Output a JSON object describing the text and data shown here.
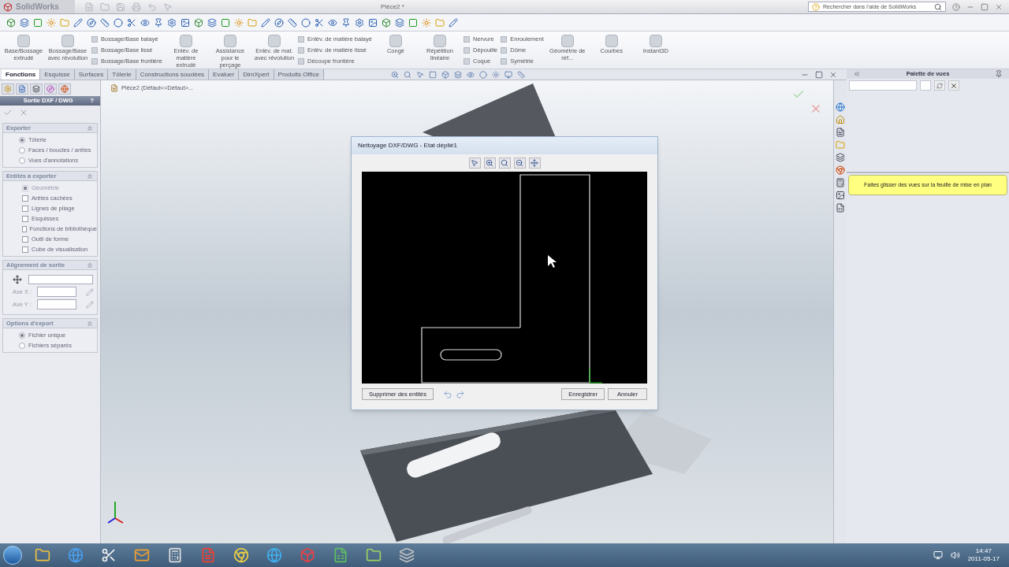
{
  "app_bar": {
    "logo": "SolidWorks",
    "title": "Pièce2 *",
    "search": {
      "placeholder": "Rechercher dans l'aide de SolidWorks"
    }
  },
  "ribbon": [
    {
      "kind": "large",
      "label": "Base/Bossage extrudé"
    },
    {
      "kind": "large",
      "label": "Bossage/Base avec révolution"
    },
    {
      "kind": "stack",
      "labels": [
        "Bossage/Base balayé",
        "Bossage/Base lissé",
        "Bossage/Base frontière"
      ]
    },
    {
      "kind": "large",
      "label": "Enlèv. de matière extrudé"
    },
    {
      "kind": "large",
      "label": "Assistance pour le perçage"
    },
    {
      "kind": "large",
      "label": "Enlèv. de mat. avec révolution"
    },
    {
      "kind": "stack",
      "labels": [
        "Enlèv. de matière balayé",
        "Enlèv. de matière lissé",
        "Découpe frontière"
      ]
    },
    {
      "kind": "large",
      "label": "Congé"
    },
    {
      "kind": "large",
      "label": "Répétition linéaire"
    },
    {
      "kind": "stack",
      "labels": [
        "Nervure",
        "Dépouille",
        "Coque"
      ]
    },
    {
      "kind": "stack",
      "labels": [
        "Enroulement",
        "Dôme",
        "Symétrie"
      ]
    },
    {
      "kind": "large",
      "label": "Géométrie de réf..."
    },
    {
      "kind": "large",
      "label": "Courbes"
    },
    {
      "kind": "large",
      "label": "Instant3D"
    }
  ],
  "tabs": [
    {
      "label": "Fonctions",
      "selected": true
    },
    {
      "label": "Esquisse",
      "selected": false
    },
    {
      "label": "Surfaces",
      "selected": false
    },
    {
      "label": "Tôlerie",
      "selected": false
    },
    {
      "label": "Constructions soudées",
      "selected": false
    },
    {
      "label": "Evaluer",
      "selected": false
    },
    {
      "label": "DimXpert",
      "selected": false
    },
    {
      "label": "Produits Office",
      "selected": false
    }
  ],
  "property_manager": {
    "title": "Sortie DXF / DWG",
    "help": "?",
    "sections": [
      {
        "title": "Exporter",
        "kind": "radios",
        "items": [
          {
            "label": "Tôlerie",
            "selected": true
          },
          {
            "label": "Faces / boucles / arêtes",
            "selected": false
          },
          {
            "label": "Vues d'annotations",
            "selected": false
          }
        ]
      },
      {
        "title": "Entités à exporter",
        "kind": "checks",
        "items": [
          {
            "label": "Géométrie",
            "checked": true,
            "disabled": true
          },
          {
            "label": "Arêtes cachées",
            "checked": false,
            "disabled": false
          },
          {
            "label": "Lignes de pliage",
            "checked": false,
            "disabled": false
          },
          {
            "label": "Esquisses",
            "checked": false,
            "disabled": false
          },
          {
            "label": "Fonctions de bibliothèque",
            "checked": false,
            "disabled": false
          },
          {
            "label": "Outil de forme",
            "checked": false,
            "disabled": false
          },
          {
            "label": "Cube de visualisation",
            "checked": false,
            "disabled": false
          }
        ]
      },
      {
        "title": "Alignement de sortie",
        "kind": "alignment",
        "fields": [
          {
            "label": "Axe X :"
          },
          {
            "label": "Axe Y :"
          }
        ]
      },
      {
        "title": "Options d'export",
        "kind": "radios",
        "items": [
          {
            "label": "Fichier unique",
            "selected": true
          },
          {
            "label": "Fichiers séparés",
            "selected": false
          }
        ]
      }
    ]
  },
  "tree_item": "Pièce2  (Défaut<<Défaut>...",
  "dialog": {
    "title": "Nettoyage DXF/DWG - Etat déplié1",
    "delete_button": "Supprimer des entités",
    "save_button": "Enregistrer",
    "cancel_button": "Annuler"
  },
  "view_palette": {
    "title": "Palette de vues",
    "note": "Faites glisser des vues sur la feuille de mise en plan"
  },
  "taskbar": {
    "time": "14:47",
    "date": "2011-05-17"
  }
}
